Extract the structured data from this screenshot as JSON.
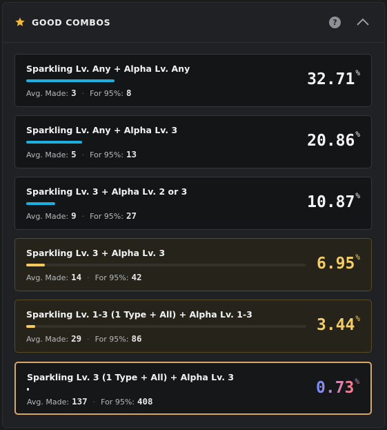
{
  "header": {
    "title": "GOOD COMBOS",
    "help_label": "?"
  },
  "colors": {
    "accent_blue": "#1ab0e0",
    "gold": "#f3cd68",
    "gold_bar": "#f5c95c"
  },
  "stat_labels": {
    "avg": "Avg. Made:",
    "for95": "For 95%:",
    "separator": "·"
  },
  "combos": [
    {
      "title": "Sparkling Lv. Any + Alpha Lv. Any",
      "avg": "3",
      "for95": "8",
      "percent": "32.71",
      "percent_sign": "%",
      "fill_fraction": 0.3271,
      "tier": "normal"
    },
    {
      "title": "Sparkling Lv. Any + Alpha Lv. 3",
      "avg": "5",
      "for95": "13",
      "percent": "20.86",
      "percent_sign": "%",
      "fill_fraction": 0.2086,
      "tier": "normal"
    },
    {
      "title": "Sparkling Lv. 3 + Alpha Lv. 2 or 3",
      "avg": "9",
      "for95": "27",
      "percent": "10.87",
      "percent_sign": "%",
      "fill_fraction": 0.1087,
      "tier": "normal"
    },
    {
      "title": "Sparkling Lv. 3 + Alpha Lv. 3",
      "avg": "14",
      "for95": "42",
      "percent": "6.95",
      "percent_sign": "%",
      "fill_fraction": 0.0695,
      "tier": "gold"
    },
    {
      "title": "Sparkling Lv. 1-3 (1 Type + All) + Alpha Lv. 1-3",
      "avg": "29",
      "for95": "86",
      "percent": "3.44",
      "percent_sign": "%",
      "fill_fraction": 0.0344,
      "tier": "gold"
    },
    {
      "title": "Sparkling Lv. 3 (1 Type + All) + Alpha Lv. 3",
      "avg": "137",
      "for95": "408",
      "percent": "0.73",
      "percent_sign": "%",
      "fill_fraction": 0.0073,
      "tier": "rainbow"
    }
  ]
}
